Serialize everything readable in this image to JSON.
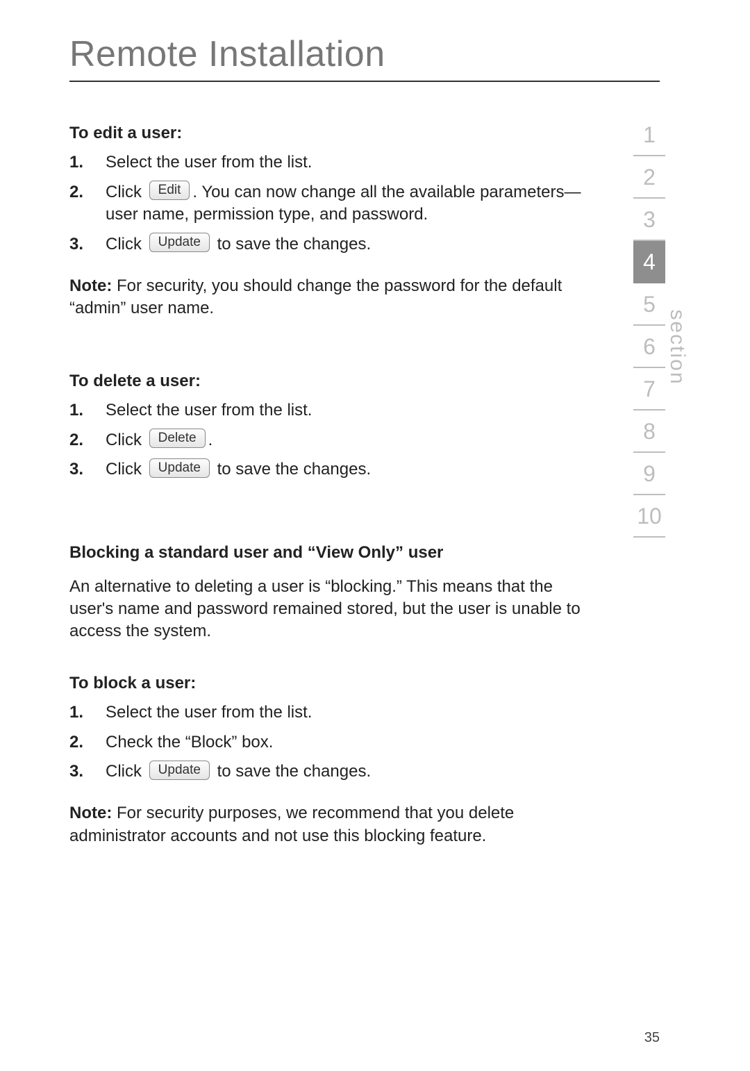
{
  "title": "Remote Installation",
  "page_number": "35",
  "section_label": "section",
  "section_nav": {
    "items": [
      "1",
      "2",
      "3",
      "4",
      "5",
      "6",
      "7",
      "8",
      "9",
      "10"
    ],
    "active_index": 3
  },
  "buttons": {
    "edit": "Edit",
    "update": "Update",
    "delete": "Delete"
  },
  "edit_user": {
    "heading": "To edit a user:",
    "step1_num": "1.",
    "step1": "Select the user from the list.",
    "step2_num": "2.",
    "step2_a": "Click ",
    "step2_b": ". You can now change all the available parameters—user name, permission type, and password.",
    "step3_num": "3.",
    "step3_a": "Click ",
    "step3_b": " to save the changes.",
    "note_label": "Note:",
    "note_text": " For security, you should change the password for the default “admin” user name."
  },
  "delete_user": {
    "heading": "To delete a user:",
    "step1_num": "1.",
    "step1": "Select the user from the list.",
    "step2_num": "2.",
    "step2_a": "Click ",
    "step2_b": ".",
    "step3_num": "3.",
    "step3_a": "Click ",
    "step3_b": " to save the changes."
  },
  "blocking": {
    "heading": "Blocking a standard user and “View Only” user",
    "para": "An alternative to deleting a user is “blocking.” This means that the user's name and password remained stored, but the user is unable to access the system."
  },
  "block_user": {
    "heading": "To block a user:",
    "step1_num": "1.",
    "step1": "Select the user from the list.",
    "step2_num": "2.",
    "step2": "Check the “Block” box.",
    "step3_num": "3.",
    "step3_a": "Click ",
    "step3_b": " to save the changes.",
    "note_label": "Note:",
    "note_text": " For security purposes, we recommend that you delete administrator accounts and not use this blocking feature."
  }
}
